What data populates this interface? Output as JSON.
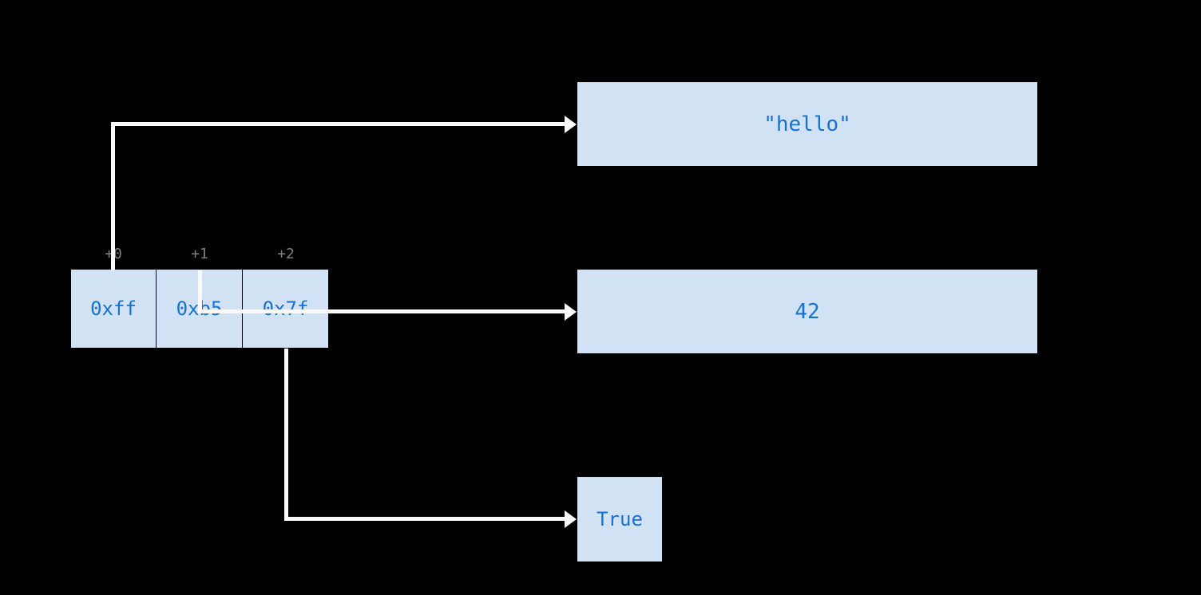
{
  "tuple": {
    "offsets": [
      "+0",
      "+1",
      "+2"
    ],
    "bytes": [
      "0xff",
      "0xb5",
      "0x7f"
    ]
  },
  "objects": {
    "string": "\"hello\"",
    "integer": "42",
    "boolean": "True"
  },
  "arrows": [
    {
      "from": "byte-0",
      "to": "object-string"
    },
    {
      "from": "byte-1",
      "to": "object-integer"
    },
    {
      "from": "byte-2",
      "to": "object-boolean"
    }
  ],
  "colors": {
    "background": "#000000",
    "cellFill": "#d1e2f4",
    "cellText": "#1771d1",
    "offsetText": "#808080",
    "arrowColor": "#fafafa"
  }
}
